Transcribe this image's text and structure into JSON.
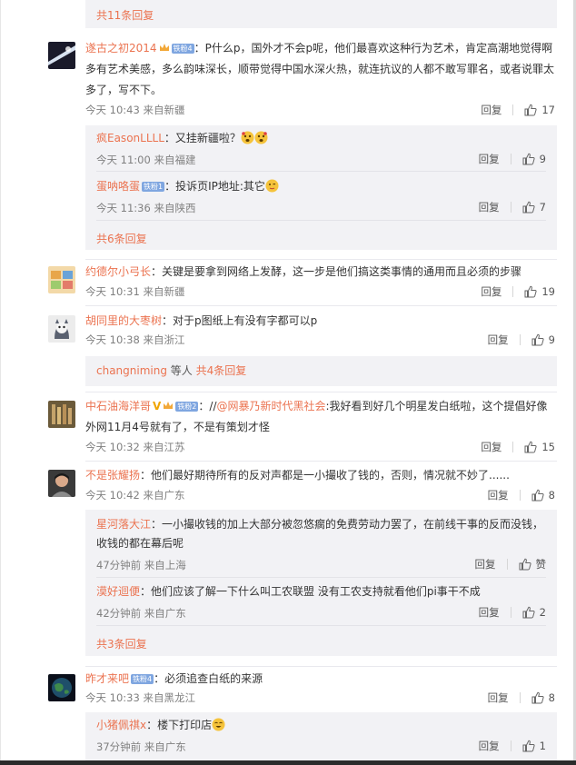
{
  "top_panel": {
    "more_label": "共11条回复"
  },
  "comments": [
    {
      "user": "遂古之初2014",
      "badge": "铁粉4",
      "text": "：P什么p，国外才不会p呢，他们最喜欢这种行为艺术，肯定高潮地觉得啊",
      "text2": "多有艺术美感，多么韵味深长，顺带觉得中国水深火热，就连抗议的人都不敢写罪名，或者说罪太",
      "text3": "多了，写不下。",
      "meta": "今天 10:43 来自新疆",
      "reply_label": "回复",
      "likes": "17",
      "subreplies": [
        {
          "user": "疯EasonLLLL",
          "text": "：又挂新疆啦？",
          "meta": "今天 11:00 来自福建",
          "reply_label": "回复",
          "likes": "9"
        },
        {
          "user": "蛋呐咯蛋",
          "badge": "铁粉1",
          "text": "：投诉页IP地址:其它",
          "meta": "今天 11:36 来自陕西",
          "reply_label": "回复",
          "likes": "7"
        }
      ],
      "more_label": "共6条回复"
    },
    {
      "user": "约德尔小弓长",
      "text": "：关键是要拿到网络上发酵，这一步是他们搞这类事情的通用而且必须的步骤",
      "meta": "今天 10:31 来自新疆",
      "reply_label": "回复",
      "likes": "19"
    },
    {
      "user": "胡同里的大枣树",
      "text": "：对于p图纸上有没有字都可以p",
      "meta": "今天 10:38 来自浙江",
      "reply_label": "回复",
      "likes": "9",
      "more_user": "changniming",
      "more_mid": " 等人 ",
      "more_label": "共4条回复"
    },
    {
      "user": "中石油海洋哥",
      "badge": "铁粉2",
      "text_prefix": "：//",
      "mention": "@网暴乃新时代黑社会",
      "text": ":我好看到好几个明星发白纸啦，这个提倡好像",
      "text2": "外网11月4号就有了，不是有策划才怪",
      "meta": "今天 10:32 来自江苏",
      "reply_label": "回复",
      "likes": "15"
    },
    {
      "user": "不是张耀扬",
      "text": "：他们最好期待所有的反对声都是一小撮收了钱的，否则，情况就不妙了......",
      "meta": "今天 10:42 来自广东",
      "reply_label": "回复",
      "likes": "8",
      "subreplies": [
        {
          "user": "星河落大江",
          "text": "：一小撮收钱的加上大部分被忽悠瘸的免费劳动力罢了，在前线干事的反而没钱，",
          "text2": "收钱的都在幕后呢",
          "meta": "47分钟前 来自上海",
          "reply_label": "回复",
          "likes": "赞"
        },
        {
          "user": "漠好迴便",
          "text": "：他们应该了解一下什么叫工农联盟 没有工农支持就看他们pi事干不成",
          "meta": "42分钟前 来自广东",
          "reply_label": "回复",
          "likes": "2"
        }
      ],
      "more_label": "共3条回复"
    },
    {
      "user": "昨才来吧",
      "badge": "铁粉4",
      "text": "：必须追查白纸的来源",
      "meta": "今天 10:33 来自黑龙江",
      "reply_label": "回复",
      "likes": "8",
      "subreplies": [
        {
          "user": "小猪佩祺x",
          "text": "：楼下打印店",
          "meta": "37分钟前 来自广东",
          "reply_label": "回复",
          "likes": "1"
        }
      ]
    }
  ],
  "colors": {
    "username": "#eb7350",
    "panel_bg": "#f2f2f5",
    "meta": "#808080"
  }
}
